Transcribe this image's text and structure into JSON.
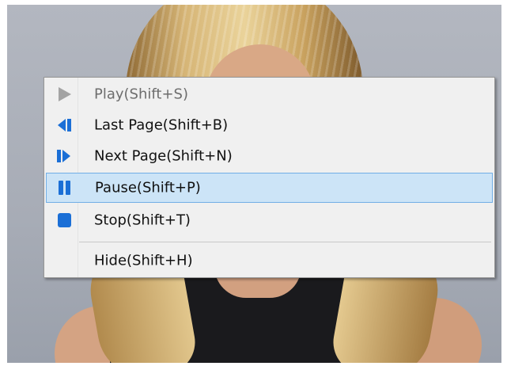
{
  "menu": {
    "items": [
      {
        "label": "Play(Shift+S)",
        "icon": "play-icon",
        "disabled": true
      },
      {
        "label": "Last Page(Shift+B)",
        "icon": "previous-page-icon",
        "disabled": false
      },
      {
        "label": "Next Page(Shift+N)",
        "icon": "next-page-icon",
        "disabled": false
      },
      {
        "label": "Pause(Shift+P)",
        "icon": "pause-icon",
        "disabled": false,
        "highlighted": true
      },
      {
        "label": "Stop(Shift+T)",
        "icon": "stop-icon",
        "disabled": false
      },
      {
        "label": "Hide(Shift+H)",
        "icon": "",
        "disabled": false
      }
    ]
  },
  "colors": {
    "icon_blue": "#1b6fd6",
    "icon_disabled": "#a3a3a3",
    "highlight_bg": "#cce4f7",
    "highlight_border": "#71aee6"
  }
}
